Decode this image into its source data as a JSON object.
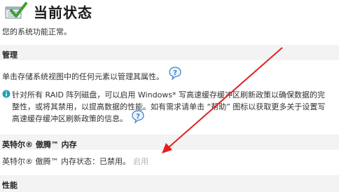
{
  "header": {
    "title": "当前状态",
    "icon": "status-ok-icon"
  },
  "status_text": "您的系统功能正常。",
  "management": {
    "heading": "管理",
    "text": "单击存储系统视图中的任何元素以管理其属性。",
    "help_icon": "help-icon"
  },
  "raid_info": {
    "icon": "info-icon",
    "line1": "针对所有 RAID 阵列磁盘，可以启用 Windows* 写高速缓存缓冲区刷新政策以确保数据的完",
    "line2": "整性，或将其禁用，以提高数据的性能。如有需求请单击 “帮助” 图标以获取更多关于设置写",
    "line3": "高速缓存缓冲区刷新政策的信息。"
  },
  "optane": {
    "heading": "英特尔® 傲腾™ 内存",
    "status": "英特尔® 傲腾™ 内存状态：已禁用。",
    "enable_label": "启用"
  },
  "performance": {
    "heading": "性能"
  },
  "colors": {
    "arrow": "#e02020",
    "section_band": "#f3f3f3",
    "disabled_link": "#b5b5b5",
    "help_blue": "#3a7fc8",
    "info_teal": "#1f9fb5",
    "check_green": "#3f9f2f"
  }
}
